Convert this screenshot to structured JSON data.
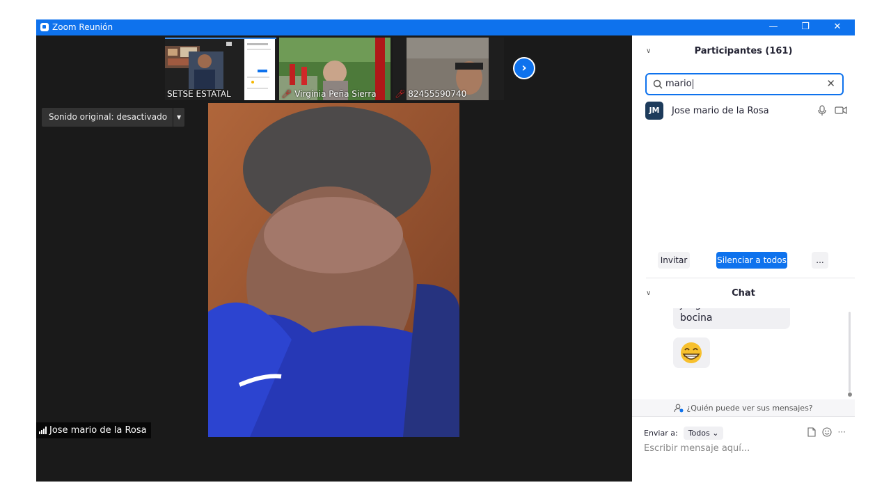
{
  "window": {
    "title": "Zoom Reunión",
    "controls": [
      "—",
      "❐",
      "✕"
    ]
  },
  "thumbnails": [
    {
      "name": "SETSE ESTATAL",
      "muted": false
    },
    {
      "name": "Virginia Peña Sierra",
      "muted": true
    },
    {
      "name": "82455590740",
      "muted": true
    }
  ],
  "audio_button": {
    "label": "Sonido original: desactivado"
  },
  "active_speaker": {
    "name": "Jose mario de la Rosa"
  },
  "participants": {
    "header": "Participantes (161)",
    "search_value": "mario",
    "list": [
      {
        "initials": "JM",
        "name": "Jose mario de la Rosa"
      }
    ],
    "invite_label": "Invitar",
    "mute_all_label": "Silenciar a todos",
    "more_label": "..."
  },
  "chat": {
    "header": "Chat",
    "message_text": "juego de cubiertos o bocina",
    "who_can_see": "¿Quién puede ver sus mensajes?",
    "send_to_label": "Enviar a:",
    "send_to_value": "Todos",
    "input_placeholder": "Escribir mensaje aquí...",
    "tools_more": "···"
  },
  "colors": {
    "accent": "#0e72ed",
    "muted_red": "#e02828",
    "video_bg": "#1a1a1a"
  }
}
